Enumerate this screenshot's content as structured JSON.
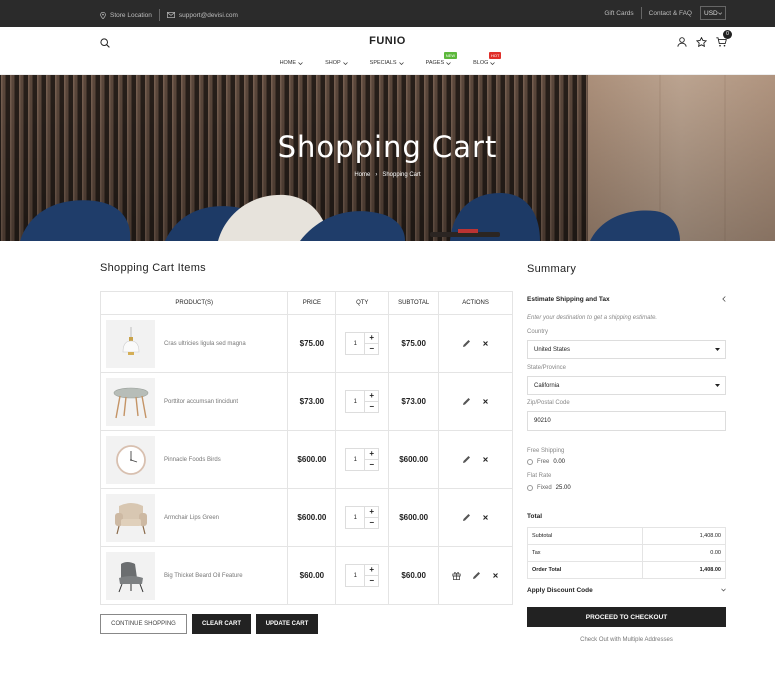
{
  "topbar": {
    "store_location": "Store Location",
    "email": "support@devisi.com",
    "gift_cards": "Gift Cards",
    "contact": "Contact & FAQ",
    "currency": "USD"
  },
  "header": {
    "logo": "FUNIO",
    "cart_count": "0",
    "nav": [
      {
        "label": "Home",
        "tag": ""
      },
      {
        "label": "Shop",
        "tag": ""
      },
      {
        "label": "Specials",
        "tag": ""
      },
      {
        "label": "Pages",
        "tag": "NEW",
        "tag_color": "#5cb83b"
      },
      {
        "label": "Blog",
        "tag": "HOT",
        "tag_color": "#e0302b"
      }
    ]
  },
  "hero": {
    "title": "Shopping Cart",
    "crumb_home": "Home",
    "crumb_sep": "›",
    "crumb_current": "Shopping Cart"
  },
  "cart": {
    "title": "Shopping Cart Items",
    "headers": [
      "Product(s)",
      "Price",
      "Qty",
      "Subtotal",
      "Actions"
    ],
    "items": [
      {
        "name": "Cras ultricies ligula sed magna",
        "price": "$75.00",
        "qty": "1",
        "subtotal": "$75.00",
        "icon": "pendant-lamp"
      },
      {
        "name": "Porttitor accumsan tincidunt",
        "price": "$73.00",
        "qty": "1",
        "subtotal": "$73.00",
        "icon": "round-table"
      },
      {
        "name": "Pinnacle Foods Birds",
        "price": "$600.00",
        "qty": "1",
        "subtotal": "$600.00",
        "icon": "wall-clock"
      },
      {
        "name": "Armchair Lips Green",
        "price": "$600.00",
        "qty": "1",
        "subtotal": "$600.00",
        "icon": "armchair"
      },
      {
        "name": "Big Thicket Beard Oil Feature",
        "price": "$60.00",
        "qty": "1",
        "subtotal": "$60.00",
        "icon": "lounge-chair"
      }
    ],
    "continue_label": "Continue Shopping",
    "clear_label": "Clear Cart",
    "update_label": "Update Cart"
  },
  "summary": {
    "title": "Summary",
    "shipping_title": "Estimate Shipping and Tax",
    "shipping_note": "Enter your destination to get a shipping estimate.",
    "country_label": "Country",
    "country_value": "United States",
    "state_label": "State/Province",
    "state_value": "California",
    "zip_label": "Zip/Postal Code",
    "zip_value": "90210",
    "free_shipping_label": "Free Shipping",
    "free_option": "Free",
    "free_price": "0.00",
    "flat_rate_label": "Flat Rate",
    "fixed_option": "Fixed",
    "fixed_price": "25.00",
    "total_title": "Total",
    "totals": [
      {
        "label": "Subtotal",
        "value": "1,408.00",
        "bold": false
      },
      {
        "label": "Tax",
        "value": "0.00",
        "bold": false
      },
      {
        "label": "Order Total",
        "value": "1,408.00",
        "bold": true
      }
    ],
    "discount_title": "Apply Discount Code",
    "checkout_label": "Proceed to Checkout",
    "multi_address": "Check Out with Multiple Addresses"
  }
}
